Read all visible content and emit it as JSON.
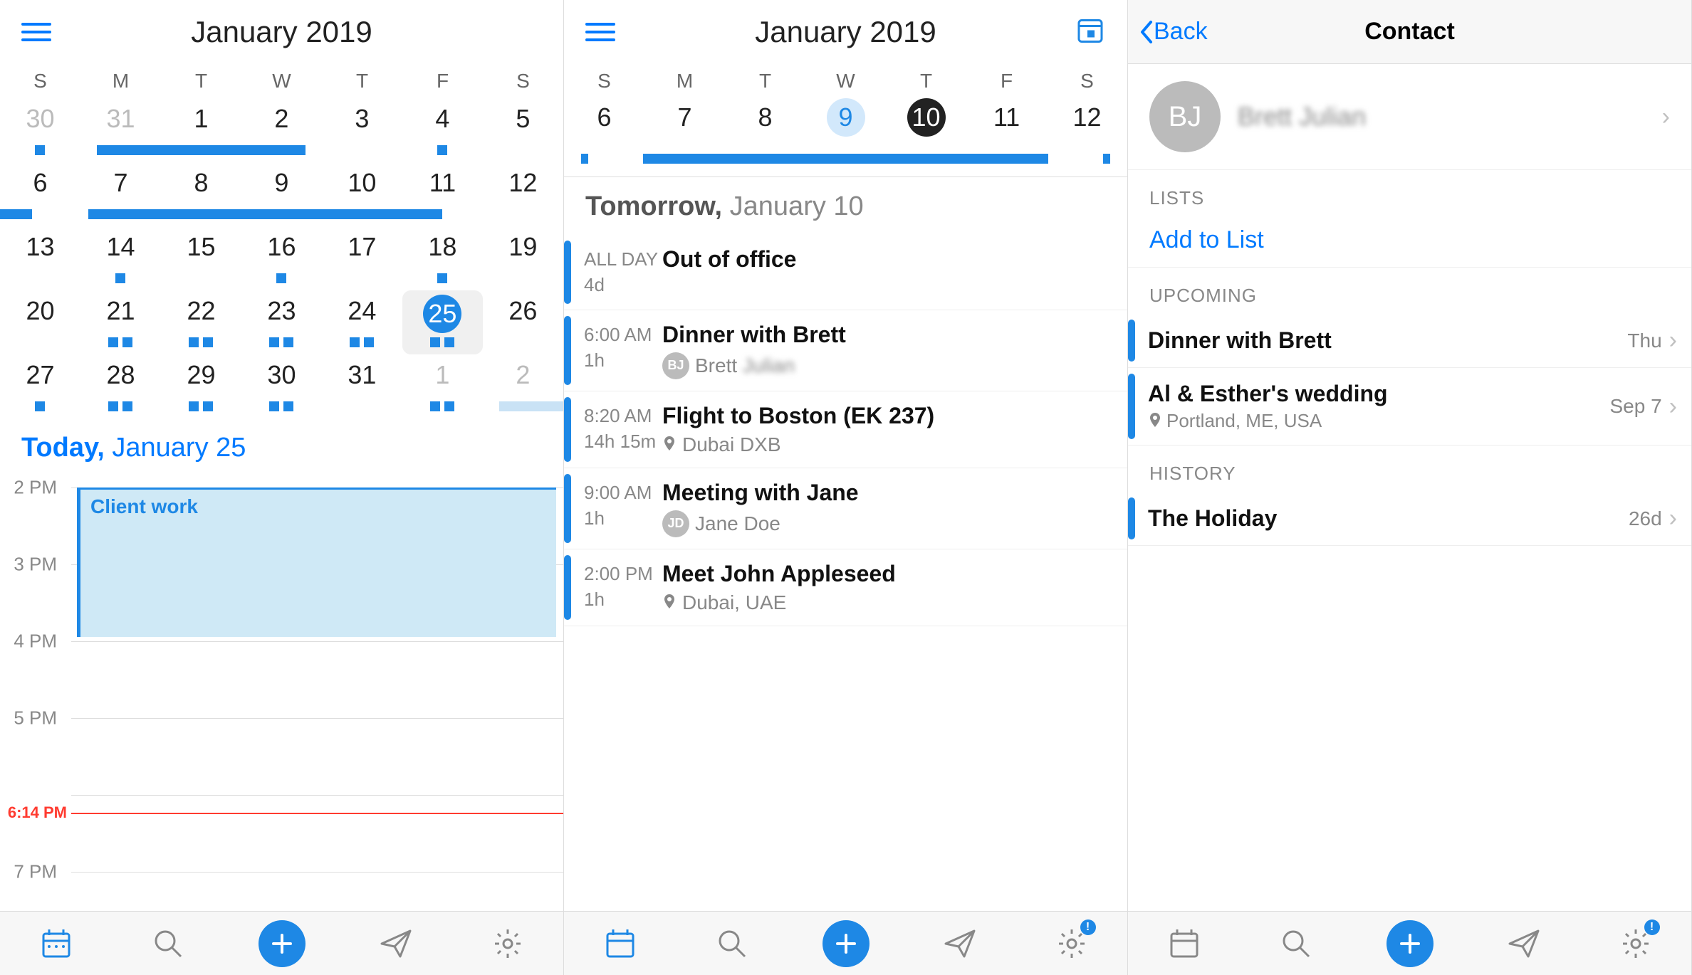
{
  "panel1": {
    "month_title": "January 2019",
    "weekdays": [
      "S",
      "M",
      "T",
      "W",
      "T",
      "F",
      "S"
    ],
    "today_prefix": "Today, ",
    "today_date": "January 25",
    "hours": [
      "2 PM",
      "3 PM",
      "4 PM",
      "5 PM",
      "7 PM"
    ],
    "now_time": "6:14 PM",
    "event_title": "Client work",
    "grid": [
      [
        {
          "n": 30,
          "o": true
        },
        {
          "n": 31,
          "o": true
        },
        {
          "n": 1
        },
        {
          "n": 2
        },
        {
          "n": 3
        },
        {
          "n": 4
        },
        {
          "n": 5
        }
      ],
      [
        {
          "n": 6
        },
        {
          "n": 7
        },
        {
          "n": 8
        },
        {
          "n": 9
        },
        {
          "n": 10
        },
        {
          "n": 11
        },
        {
          "n": 12
        }
      ],
      [
        {
          "n": 13
        },
        {
          "n": 14
        },
        {
          "n": 15
        },
        {
          "n": 16
        },
        {
          "n": 17
        },
        {
          "n": 18
        },
        {
          "n": 19
        }
      ],
      [
        {
          "n": 20
        },
        {
          "n": 21
        },
        {
          "n": 22
        },
        {
          "n": 23
        },
        {
          "n": 24
        },
        {
          "n": 25,
          "sel": true
        },
        {
          "n": 26
        }
      ],
      [
        {
          "n": 27
        },
        {
          "n": 28
        },
        {
          "n": 29
        },
        {
          "n": 30
        },
        {
          "n": 31
        },
        {
          "n": 1,
          "o": true
        },
        {
          "n": 2,
          "o": true
        }
      ]
    ]
  },
  "panel2": {
    "month_title": "January 2019",
    "weekdays": [
      "S",
      "M",
      "T",
      "W",
      "T",
      "F",
      "S"
    ],
    "weeknums": [
      "6",
      "7",
      "8",
      "9",
      "10",
      "11",
      "12"
    ],
    "tomorrow_prefix": "Tomorrow, ",
    "tomorrow_date": "January 10",
    "agenda": [
      {
        "time": "ALL DAY",
        "dur": "4d",
        "title": "Out of office"
      },
      {
        "time": "6:00 AM",
        "dur": "1h",
        "title": "Dinner with Brett",
        "avatar": "BJ",
        "person": "Brett",
        "person_blur": "Julian"
      },
      {
        "time": "8:20 AM",
        "dur": "14h 15m",
        "title": "Flight to Boston (EK 237)",
        "loc": "Dubai DXB"
      },
      {
        "time": "9:00 AM",
        "dur": "1h",
        "title": "Meeting with Jane",
        "avatar": "JD",
        "person": "Jane Doe"
      },
      {
        "time": "2:00 PM",
        "dur": "1h",
        "title": "Meet John Appleseed",
        "loc": "Dubai, UAE"
      }
    ]
  },
  "panel3": {
    "back": "Back",
    "title": "Contact",
    "avatar_initials": "BJ",
    "contact_name": "Brett Julian",
    "lists_label": "LISTS",
    "add_to_list": "Add to List",
    "upcoming_label": "UPCOMING",
    "upcoming": [
      {
        "title": "Dinner with Brett",
        "when": "Thu"
      },
      {
        "title": "Al & Esther's wedding",
        "loc": "Portland, ME, USA",
        "when": "Sep 7"
      }
    ],
    "history_label": "HISTORY",
    "history": [
      {
        "title": "The Holiday",
        "when": "26d"
      }
    ]
  }
}
